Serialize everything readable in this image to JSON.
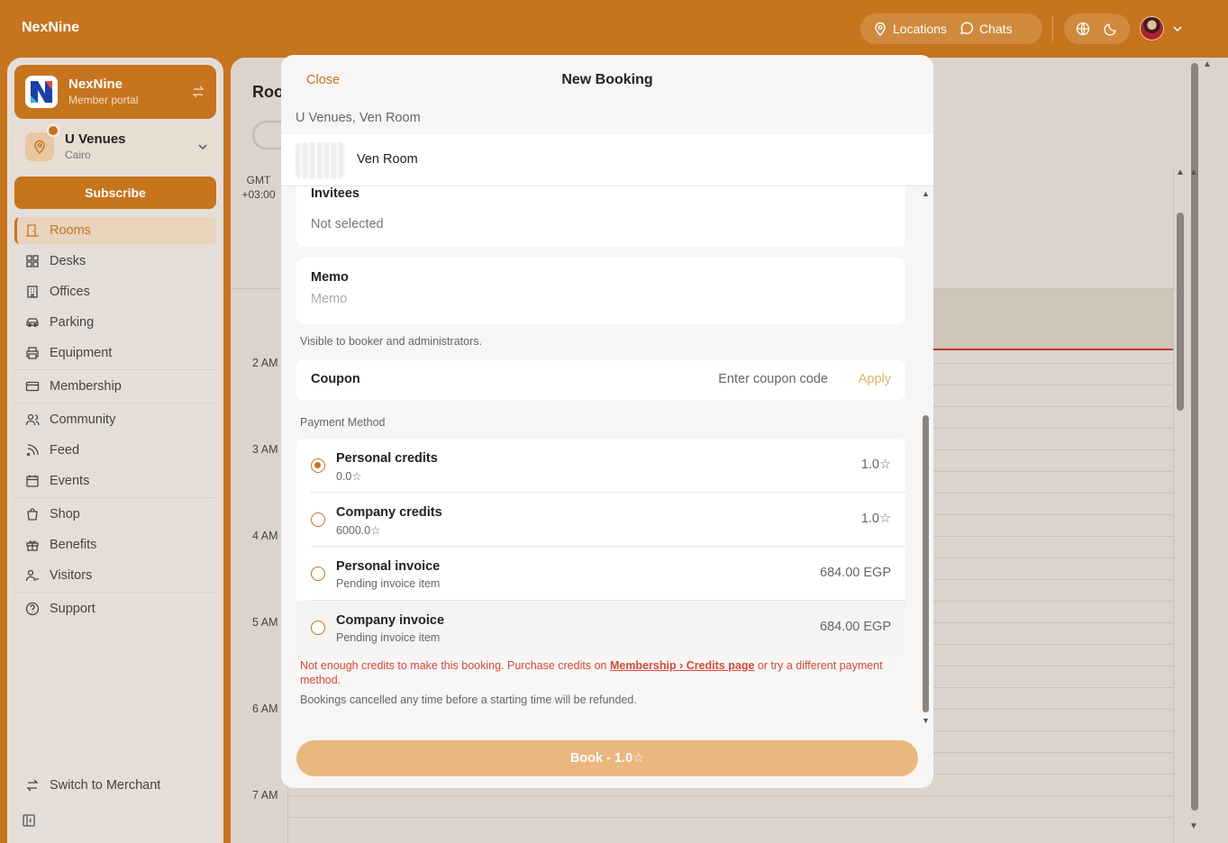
{
  "app": {
    "brand": "NexNine"
  },
  "topnav": {
    "locations": "Locations",
    "chats": "Chats"
  },
  "org": {
    "name": "NexNine",
    "subtitle": "Member portal"
  },
  "location": {
    "name": "U Venues",
    "city": "Cairo"
  },
  "sidebar": {
    "subscribe": "Subscribe",
    "items": [
      {
        "label": "Rooms",
        "icon": "door-icon"
      },
      {
        "label": "Desks",
        "icon": "grid-icon"
      },
      {
        "label": "Offices",
        "icon": "building-icon"
      },
      {
        "label": "Parking",
        "icon": "car-icon"
      },
      {
        "label": "Equipment",
        "icon": "printer-icon"
      },
      {
        "label": "Membership",
        "icon": "card-icon"
      },
      {
        "label": "Community",
        "icon": "users-icon"
      },
      {
        "label": "Feed",
        "icon": "rss-icon"
      },
      {
        "label": "Events",
        "icon": "calendar-icon"
      },
      {
        "label": "Shop",
        "icon": "bag-icon"
      },
      {
        "label": "Benefits",
        "icon": "gift-icon"
      },
      {
        "label": "Visitors",
        "icon": "visitors-icon"
      },
      {
        "label": "Support",
        "icon": "help-icon"
      }
    ],
    "switch_merchant": "Switch to Merchant"
  },
  "main": {
    "title": "Roo",
    "gmt_line1": "GMT",
    "gmt_line2": "+03:00",
    "hours": [
      "2 AM",
      "3 AM",
      "4 AM",
      "5 AM",
      "6 AM",
      "7 AM"
    ]
  },
  "modal": {
    "close": "Close",
    "title": "New Booking",
    "subtitle": "U Venues, Ven Room",
    "room_name": "Ven Room",
    "invitees_label": "Invitees",
    "invitees_value": "Not selected",
    "memo_label": "Memo",
    "memo_placeholder": "Memo",
    "memo_helper": "Visible to booker and administrators.",
    "coupon_label": "Coupon",
    "coupon_placeholder": "Enter coupon code",
    "coupon_apply": "Apply",
    "payment_label": "Payment Method",
    "payment_options": [
      {
        "name": "Personal credits",
        "detail": "0.0☆",
        "amount": "1.0☆",
        "selected": true
      },
      {
        "name": "Company credits",
        "detail": "6000.0☆",
        "amount": "1.0☆",
        "selected": false
      },
      {
        "name": "Personal invoice",
        "detail": "Pending invoice item",
        "amount": "684.00 EGP",
        "selected": false
      },
      {
        "name": "Company invoice",
        "detail": "Pending invoice item",
        "amount": "684.00 EGP",
        "selected": false
      }
    ],
    "warning_pre": "Not enough credits to make this booking. Purchase credits on ",
    "warning_link": "Membership › Credits page",
    "warning_post": " or try a different payment method.",
    "refund_note": "Bookings cancelled any time before a starting time will be refunded.",
    "book_button": "Book - 1.0☆"
  },
  "colors": {
    "accent": "#c6741e",
    "error": "#d24a3a"
  }
}
